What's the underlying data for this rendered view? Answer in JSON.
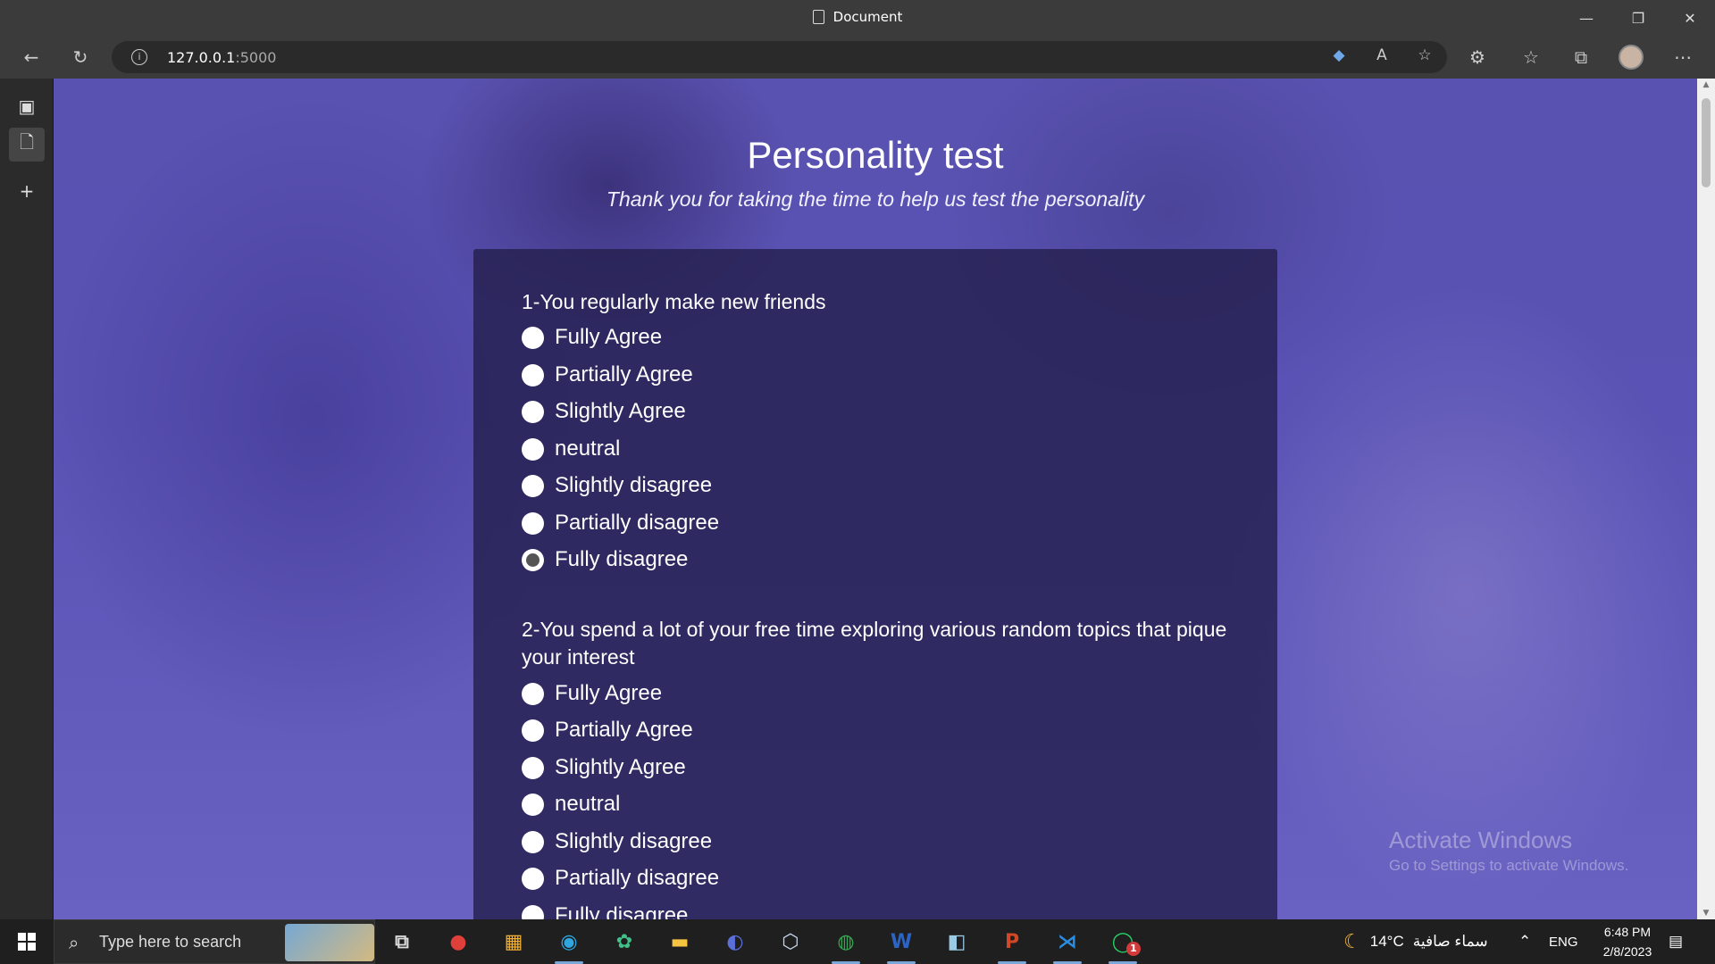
{
  "browser": {
    "tab_title": "Document",
    "url_host": "127.0.0.1",
    "url_port": ":5000"
  },
  "page": {
    "title": "Personality test",
    "subtitle": "Thank you for taking the time to help us test the personality"
  },
  "questions": [
    {
      "text": "1-You regularly make new friends",
      "options": [
        "Fully Agree",
        "Partially Agree",
        "Slightly Agree",
        "neutral",
        "Slightly disagree",
        "Partially disagree",
        "Fully disagree"
      ],
      "selected": "Fully disagree"
    },
    {
      "text": "2-You spend a lot of your free time exploring various random topics that pique your interest",
      "options": [
        "Fully Agree",
        "Partially Agree",
        "Slightly Agree",
        "neutral",
        "Slightly disagree",
        "Partially disagree",
        "Fully disagree"
      ],
      "selected": null
    }
  ],
  "watermark": {
    "line1": "Activate Windows",
    "line2": "Go to Settings to activate Windows."
  },
  "taskbar": {
    "search_placeholder": "Type here to search",
    "weather": "14°C",
    "weather_text": "سماء صافية",
    "language": "ENG",
    "time": "6:48 PM",
    "date": "2/8/2023",
    "whatsapp_badge": "1"
  }
}
